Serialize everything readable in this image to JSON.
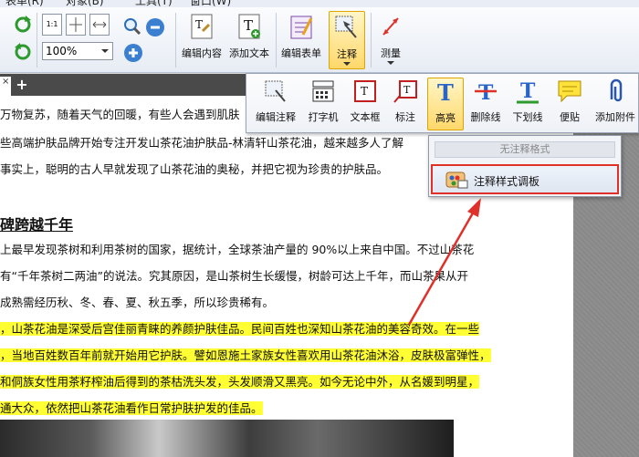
{
  "menubar": {
    "items": [
      "表单(R)",
      "对象(B)",
      "工具(T)",
      "窗口(W)"
    ]
  },
  "toolbar": {
    "zoom_value": "100%",
    "buttons": {
      "edit_content": "编辑内容",
      "add_text": "添加文本",
      "edit_form": "编辑表单",
      "annotate": "注释",
      "measure": "测量"
    }
  },
  "tabs": {
    "close": "×",
    "new": "+"
  },
  "annotation_toolbar": {
    "edit_annotation": "编辑注释",
    "typewriter": "打字机",
    "textbox": "文本框",
    "callout": "标注",
    "highlight": "高亮",
    "strikeout": "删除线",
    "underline": "下划线",
    "sticky_note": "便贴",
    "attach_file": "添加附件"
  },
  "style_dropdown": {
    "header": "无注释格式",
    "item": "注释样式调板"
  },
  "document": {
    "lines": [
      "万物复苏，随着天气的回暖，有些人会遇到肌肤",
      "些高端护肤品牌开始专注开发山茶花油护肤品-林清轩山茶花油，越来越多人了解",
      "事实上，聪明的古人早就发现了山茶花油的奥秘，并把它视为珍贵的护肤品。"
    ],
    "heading": "碑跨越千年",
    "para2": [
      "上最早发现茶树和利用茶树的国家，据统计，全球茶油产量的 90%以上来自中国。不过山茶花",
      "有“千年茶树二两油”的说法。究其原因，是山茶树生长缓慢，树龄可达上千年，而山茶果从开",
      "成熟需经历秋、冬、春、夏、秋五季，所以珍贵稀有。"
    ],
    "highlighted": [
      "，山茶花油是深受后宫佳丽青睐的养颜护肤佳品。民间百姓也深知山茶花油的美容奇效。在一些",
      "，当地百姓数百年前就开始用它护肤。譬如恩施土家族女性喜欢用山茶花油沐浴，皮肤极富弹性，",
      "和侗族女性用茶籽榨油后得到的茶枯洗头发，头发顺滑又黑亮。如今无论中外，从名媛到明星，",
      "通大众，依然把山茶花油看作日常护肤护发的佳品。"
    ]
  },
  "colors": {
    "highlight": "#ffff33",
    "callout_border": "#e0302a",
    "arrow": "#e0302a"
  }
}
